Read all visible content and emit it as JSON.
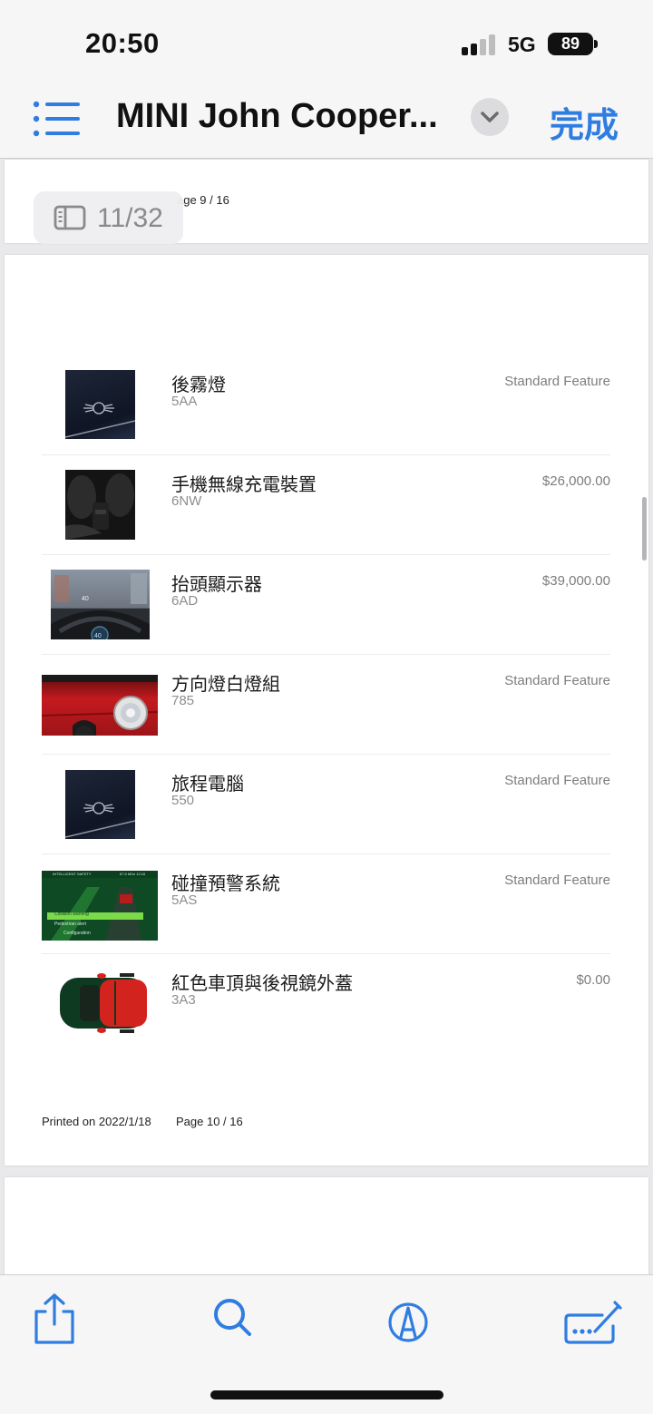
{
  "status_bar": {
    "time": "20:50",
    "network": "5G",
    "battery": "89"
  },
  "nav_bar": {
    "title": "MINI John Cooper...",
    "done_label": "完成"
  },
  "page_indicator": "11/32",
  "previous_page": {
    "page_label": "age 9 / 16"
  },
  "items": [
    {
      "name": "後霧燈",
      "code": "5AA",
      "price": "Standard Feature",
      "thumb": "mini-logo"
    },
    {
      "name": "手機無線充電裝置",
      "code": "6NW",
      "price": "$26,000.00",
      "thumb": "interior"
    },
    {
      "name": "抬頭顯示器",
      "code": "6AD",
      "price": "$39,000.00",
      "thumb": "hud"
    },
    {
      "name": "方向燈白燈組",
      "code": "785",
      "price": "Standard Feature",
      "thumb": "red-headlight"
    },
    {
      "name": "旅程電腦",
      "code": "550",
      "price": "Standard Feature",
      "thumb": "mini-logo"
    },
    {
      "name": "碰撞預警系統",
      "code": "5AS",
      "price": "Standard Feature",
      "thumb": "safety-screen"
    },
    {
      "name": "紅色車頂與後視鏡外蓋",
      "code": "3A3",
      "price": "$0.00",
      "thumb": "car-top"
    }
  ],
  "footer": {
    "printed": "Printed on 2022/1/18",
    "page": "Page 10 / 16"
  },
  "safety_screen": {
    "header": "INTELLIGENT SAFETY",
    "radio": "87.5 MHz 12:16",
    "options": [
      "Collision warning",
      "Pedestrian alert",
      "Configuration"
    ]
  },
  "toolbar": {
    "share": "share-icon",
    "search": "search-icon",
    "markup": "markup-icon",
    "edit": "edit-icon"
  },
  "colors": {
    "accent": "#2f7de1",
    "price_gray": "#7d7d7d"
  }
}
